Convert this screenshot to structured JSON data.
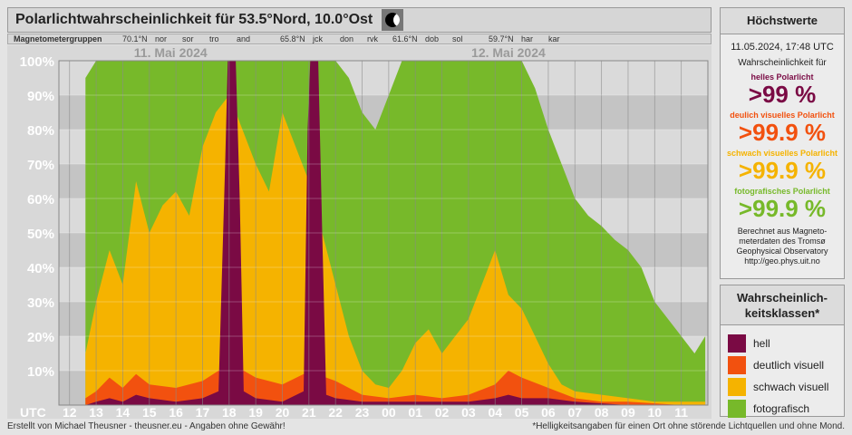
{
  "header": {
    "title": "Polarlichtwahrscheinlichkeit für  53.5°Nord, 10.0°Ost",
    "magnetometer_label": "Magnetometergruppen",
    "groups": [
      {
        "lat": "70.1°N",
        "stations": [
          "nor",
          "sor",
          "tro",
          "and"
        ]
      },
      {
        "lat": "65.8°N",
        "stations": [
          "jck",
          "don",
          "rvk"
        ]
      },
      {
        "lat": "61.6°N",
        "stations": [
          "dob",
          "sol"
        ]
      },
      {
        "lat": "59.7°N",
        "stations": [
          "har",
          "kar"
        ]
      }
    ]
  },
  "chart_data": {
    "type": "area",
    "title": "Polarlichtwahrscheinlichkeit für  53.5°Nord, 10.0°Ost",
    "xlabel": "UTC",
    "ylim": [
      0,
      100
    ],
    "y_ticks": [
      "10%",
      "20%",
      "30%",
      "40%",
      "50%",
      "60%",
      "70%",
      "80%",
      "90%",
      "100%"
    ],
    "date_labels": [
      "11. Mai 2024",
      "12. Mai 2024"
    ],
    "x_ticks": [
      "12",
      "13",
      "14",
      "15",
      "16",
      "17",
      "18",
      "19",
      "20",
      "21",
      "22",
      "23",
      "00",
      "01",
      "02",
      "03",
      "04",
      "05",
      "06",
      "07",
      "08",
      "09",
      "10",
      "11"
    ],
    "x_hours": [
      12,
      13,
      14,
      15,
      16,
      17,
      18,
      19,
      20,
      21,
      22,
      23,
      24,
      25,
      26,
      27,
      28,
      29,
      30,
      31,
      32,
      33,
      34,
      35
    ],
    "x_range": [
      11.6,
      36.0
    ],
    "stacked": true,
    "series": [
      {
        "name": "hell",
        "color": "#7a0a44",
        "points": [
          [
            12.6,
            0
          ],
          [
            13,
            1
          ],
          [
            13.5,
            2
          ],
          [
            14,
            1
          ],
          [
            14.5,
            3
          ],
          [
            15,
            2
          ],
          [
            16,
            1
          ],
          [
            17,
            2
          ],
          [
            17.6,
            4
          ],
          [
            17.85,
            70
          ],
          [
            17.95,
            100
          ],
          [
            18.25,
            100
          ],
          [
            18.4,
            60
          ],
          [
            18.55,
            4
          ],
          [
            19,
            2
          ],
          [
            20,
            1
          ],
          [
            20.8,
            4
          ],
          [
            20.95,
            80
          ],
          [
            21.05,
            100
          ],
          [
            21.35,
            100
          ],
          [
            21.5,
            50
          ],
          [
            21.65,
            3
          ],
          [
            22,
            2
          ],
          [
            23,
            1
          ],
          [
            24,
            1
          ],
          [
            25,
            1
          ],
          [
            26,
            1
          ],
          [
            27,
            1
          ],
          [
            28,
            2
          ],
          [
            28.5,
            3
          ],
          [
            29,
            2
          ],
          [
            30,
            2
          ],
          [
            31,
            1
          ],
          [
            33,
            0
          ],
          [
            35,
            0
          ],
          [
            35.9,
            0
          ]
        ]
      },
      {
        "name": "deutlich visuell",
        "color": "#f2510f",
        "points": [
          [
            12.6,
            2
          ],
          [
            13,
            4
          ],
          [
            13.5,
            8
          ],
          [
            14,
            5
          ],
          [
            14.5,
            9
          ],
          [
            15,
            6
          ],
          [
            16,
            5
          ],
          [
            17,
            7
          ],
          [
            17.6,
            10
          ],
          [
            18.55,
            10
          ],
          [
            19,
            8
          ],
          [
            20,
            6
          ],
          [
            20.8,
            9
          ],
          [
            21.65,
            8
          ],
          [
            22,
            7
          ],
          [
            23,
            3
          ],
          [
            24,
            2
          ],
          [
            25,
            3
          ],
          [
            26,
            2
          ],
          [
            27,
            3
          ],
          [
            28,
            6
          ],
          [
            28.5,
            10
          ],
          [
            29,
            8
          ],
          [
            30,
            5
          ],
          [
            31,
            2
          ],
          [
            32,
            1
          ],
          [
            33,
            1
          ],
          [
            35,
            0
          ],
          [
            35.9,
            0
          ]
        ]
      },
      {
        "name": "schwach visuell",
        "color": "#f5b300",
        "points": [
          [
            12.6,
            15
          ],
          [
            13,
            30
          ],
          [
            13.5,
            45
          ],
          [
            14,
            35
          ],
          [
            14.5,
            65
          ],
          [
            15,
            50
          ],
          [
            15.5,
            58
          ],
          [
            16,
            62
          ],
          [
            16.5,
            55
          ],
          [
            17,
            75
          ],
          [
            17.5,
            85
          ],
          [
            18,
            90
          ],
          [
            18.5,
            80
          ],
          [
            19,
            70
          ],
          [
            19.5,
            62
          ],
          [
            20,
            85
          ],
          [
            20.5,
            75
          ],
          [
            21,
            65
          ],
          [
            22,
            35
          ],
          [
            22.5,
            20
          ],
          [
            23,
            10
          ],
          [
            23.5,
            6
          ],
          [
            24,
            5
          ],
          [
            24.5,
            10
          ],
          [
            25,
            18
          ],
          [
            25.5,
            22
          ],
          [
            26,
            15
          ],
          [
            26.5,
            20
          ],
          [
            27,
            25
          ],
          [
            27.5,
            35
          ],
          [
            28,
            45
          ],
          [
            28.5,
            32
          ],
          [
            29,
            28
          ],
          [
            29.5,
            20
          ],
          [
            30,
            12
          ],
          [
            30.5,
            6
          ],
          [
            31,
            4
          ],
          [
            32,
            3
          ],
          [
            33,
            2
          ],
          [
            34,
            1
          ],
          [
            35,
            1
          ],
          [
            35.9,
            1
          ]
        ]
      },
      {
        "name": "fotografisch",
        "color": "#77b92a",
        "points": [
          [
            12.6,
            95
          ],
          [
            13,
            100
          ],
          [
            16,
            100
          ],
          [
            17,
            100
          ],
          [
            20,
            100
          ],
          [
            21,
            100
          ],
          [
            22,
            100
          ],
          [
            22.5,
            95
          ],
          [
            23,
            85
          ],
          [
            23.5,
            80
          ],
          [
            24,
            90
          ],
          [
            24.5,
            100
          ],
          [
            26,
            100
          ],
          [
            27,
            100
          ],
          [
            28,
            100
          ],
          [
            29,
            100
          ],
          [
            29.5,
            92
          ],
          [
            30,
            80
          ],
          [
            30.5,
            70
          ],
          [
            31,
            60
          ],
          [
            31.5,
            55
          ],
          [
            32,
            52
          ],
          [
            32.5,
            48
          ],
          [
            33,
            45
          ],
          [
            33.5,
            40
          ],
          [
            34,
            30
          ],
          [
            34.5,
            25
          ],
          [
            35,
            20
          ],
          [
            35.5,
            15
          ],
          [
            35.9,
            20
          ]
        ]
      }
    ]
  },
  "summary": {
    "heading": "Höchstwerte",
    "datetime": "11.05.2024, 17:48 UTC",
    "prob_label": "Wahrscheinlichkeit für",
    "items": [
      {
        "label": "helles Polarlicht",
        "value": ">99 %",
        "color": "#7a0a44"
      },
      {
        "label": "deulich visuelles Polarlicht",
        "value": ">99.9 %",
        "color": "#f2510f"
      },
      {
        "label": "schwach visuelles Polarlicht",
        "value": ">99.9 %",
        "color": "#f5b300"
      },
      {
        "label": "fotografisches Polarlicht",
        "value": ">99.9 %",
        "color": "#77b92a"
      }
    ],
    "source_lines": [
      "Berechnet aus Magneto-",
      "meterdaten des Tromsø",
      "Geophysical Observatory",
      "http://geo.phys.uit.no"
    ]
  },
  "legend": {
    "heading_line1": "Wahrscheinlich-",
    "heading_line2": "keitsklassen*",
    "items": [
      {
        "label": "hell",
        "color": "#7a0a44"
      },
      {
        "label": "deutlich visuell",
        "color": "#f2510f"
      },
      {
        "label": "schwach visuell",
        "color": "#f5b300"
      },
      {
        "label": "fotografisch",
        "color": "#77b92a"
      }
    ]
  },
  "footer": {
    "left": "Erstellt von Michael Theusner - theusner.eu - Angaben ohne Gewähr!",
    "right": "*Helligkeitsangaben für einen Ort ohne störende Lichtquellen und ohne Mond."
  }
}
